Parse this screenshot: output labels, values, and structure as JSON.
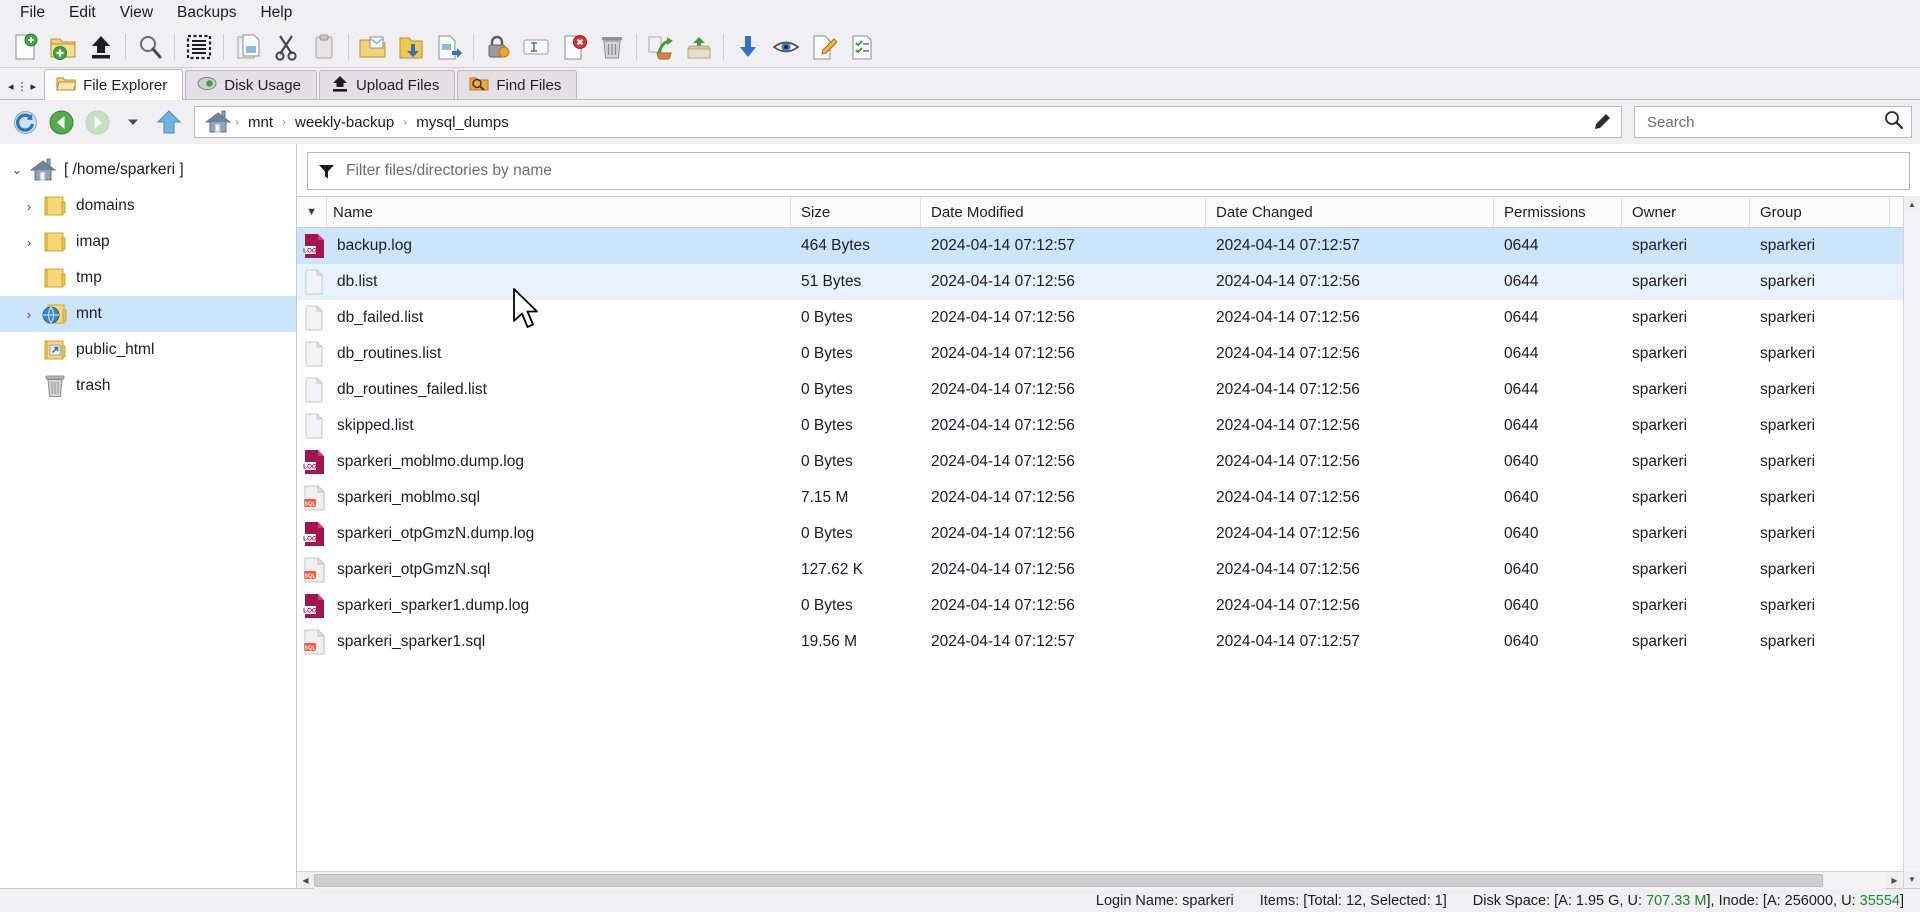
{
  "menubar": {
    "items": [
      {
        "label": "File",
        "name": "menu-file"
      },
      {
        "label": "Edit",
        "name": "menu-edit"
      },
      {
        "label": "View",
        "name": "menu-view"
      },
      {
        "label": "Backups",
        "name": "menu-backups"
      },
      {
        "label": "Help",
        "name": "menu-help"
      }
    ]
  },
  "toolbar": {
    "buttons": [
      {
        "icon": "new-file-icon",
        "group": 0
      },
      {
        "icon": "new-folder-icon",
        "group": 0
      },
      {
        "icon": "upload-icon",
        "group": 0
      },
      {
        "icon": "search-icon",
        "group": 1
      },
      {
        "icon": "select-all-icon",
        "group": 1
      },
      {
        "icon": "copy-icon",
        "group": 2
      },
      {
        "icon": "cut-icon",
        "group": 2
      },
      {
        "icon": "paste-icon",
        "group": 2
      },
      {
        "icon": "move-to-folder-icon",
        "group": 3
      },
      {
        "icon": "download-folder-icon",
        "group": 3
      },
      {
        "icon": "extract-archive-icon",
        "group": 3
      },
      {
        "icon": "permissions-lock-icon",
        "group": 4
      },
      {
        "icon": "rename-icon",
        "group": 4
      },
      {
        "icon": "delete-file-icon",
        "group": 4
      },
      {
        "icon": "trash-icon",
        "group": 4
      },
      {
        "icon": "restore-icon",
        "group": 5
      },
      {
        "icon": "archive-box-icon",
        "group": 5
      },
      {
        "icon": "download-icon",
        "group": 6
      },
      {
        "icon": "preview-eye-icon",
        "group": 6
      },
      {
        "icon": "edit-file-icon",
        "group": 6
      },
      {
        "icon": "checklist-icon",
        "group": 6
      }
    ]
  },
  "tabs": {
    "nav_prev": "◂",
    "nav_more": "⋮",
    "nav_next": "▸",
    "items": [
      {
        "label": "File Explorer",
        "icon": "folder-open-icon",
        "active": true
      },
      {
        "label": "Disk Usage",
        "icon": "disk-usage-icon",
        "active": false
      },
      {
        "label": "Upload Files",
        "icon": "upload-icon",
        "active": false
      },
      {
        "label": "Find Files",
        "icon": "find-files-icon",
        "active": false
      }
    ]
  },
  "addressbar": {
    "refresh_title": "refresh-icon",
    "back_title": "back-icon",
    "forward_title": "forward-icon",
    "history_title": "chevron-down-icon",
    "up_title": "up-icon",
    "home_title": "home-icon",
    "edit_path_title": "edit-path-icon",
    "separator": "›",
    "breadcrumbs": [
      "mnt",
      "weekly-backup",
      "mysql_dumps"
    ]
  },
  "search": {
    "placeholder": "Search",
    "value": "",
    "icon": "search-icon"
  },
  "filter": {
    "placeholder": "Filter files/directories by name",
    "value": "",
    "icon": "filter-funnel-icon"
  },
  "sidebar": {
    "items": [
      {
        "label": "[ /home/sparkeri ]",
        "icon": "home-icon",
        "twisty": "⌄",
        "expanded": true,
        "indent": 0,
        "selected": false,
        "name": "sidebar-item-home"
      },
      {
        "label": "domains",
        "icon": "folder-icon",
        "twisty": "›",
        "expanded": false,
        "indent": 1,
        "selected": false,
        "name": "sidebar-item-domains"
      },
      {
        "label": "imap",
        "icon": "folder-icon",
        "twisty": "›",
        "expanded": false,
        "indent": 1,
        "selected": false,
        "name": "sidebar-item-imap"
      },
      {
        "label": "tmp",
        "icon": "folder-icon",
        "twisty": "",
        "expanded": false,
        "indent": 1,
        "selected": false,
        "name": "sidebar-item-tmp"
      },
      {
        "label": "mnt",
        "icon": "folder-mount-icon",
        "twisty": "›",
        "expanded": false,
        "indent": 1,
        "selected": true,
        "name": "sidebar-item-mnt"
      },
      {
        "label": "public_html",
        "icon": "folder-link-icon",
        "twisty": "",
        "expanded": false,
        "indent": 1,
        "selected": false,
        "name": "sidebar-item-public-html"
      },
      {
        "label": "trash",
        "icon": "trash-icon",
        "twisty": "",
        "expanded": false,
        "indent": 1,
        "selected": false,
        "name": "sidebar-item-trash"
      }
    ]
  },
  "filelist": {
    "sort_indicator": "▼",
    "columns": [
      {
        "label": "Name",
        "key": "name",
        "cls": "c-name"
      },
      {
        "label": "Size",
        "key": "size",
        "cls": "c-size"
      },
      {
        "label": "Date Modified",
        "key": "modified",
        "cls": "c-dmod"
      },
      {
        "label": "Date Changed",
        "key": "changed",
        "cls": "c-dchg"
      },
      {
        "label": "Permissions",
        "key": "permissions",
        "cls": "c-perm"
      },
      {
        "label": "Owner",
        "key": "owner",
        "cls": "c-owner"
      },
      {
        "label": "Group",
        "key": "group",
        "cls": "c-group"
      }
    ],
    "rows": [
      {
        "name": "backup.log",
        "icon": "log-file-icon",
        "size": "464 Bytes",
        "modified": "2024-04-14 07:12:57",
        "changed": "2024-04-14 07:12:57",
        "permissions": "0644",
        "owner": "sparkeri",
        "group": "sparkeri",
        "state": "selected"
      },
      {
        "name": "db.list",
        "icon": "text-file-icon",
        "size": "51 Bytes",
        "modified": "2024-04-14 07:12:56",
        "changed": "2024-04-14 07:12:56",
        "permissions": "0644",
        "owner": "sparkeri",
        "group": "sparkeri",
        "state": "hovered"
      },
      {
        "name": "db_failed.list",
        "icon": "text-file-icon",
        "size": "0 Bytes",
        "modified": "2024-04-14 07:12:56",
        "changed": "2024-04-14 07:12:56",
        "permissions": "0644",
        "owner": "sparkeri",
        "group": "sparkeri",
        "state": ""
      },
      {
        "name": "db_routines.list",
        "icon": "text-file-icon",
        "size": "0 Bytes",
        "modified": "2024-04-14 07:12:56",
        "changed": "2024-04-14 07:12:56",
        "permissions": "0644",
        "owner": "sparkeri",
        "group": "sparkeri",
        "state": ""
      },
      {
        "name": "db_routines_failed.list",
        "icon": "text-file-icon",
        "size": "0 Bytes",
        "modified": "2024-04-14 07:12:56",
        "changed": "2024-04-14 07:12:56",
        "permissions": "0644",
        "owner": "sparkeri",
        "group": "sparkeri",
        "state": ""
      },
      {
        "name": "skipped.list",
        "icon": "text-file-icon",
        "size": "0 Bytes",
        "modified": "2024-04-14 07:12:56",
        "changed": "2024-04-14 07:12:56",
        "permissions": "0644",
        "owner": "sparkeri",
        "group": "sparkeri",
        "state": ""
      },
      {
        "name": "sparkeri_moblmo.dump.log",
        "icon": "log-file-icon",
        "size": "0 Bytes",
        "modified": "2024-04-14 07:12:56",
        "changed": "2024-04-14 07:12:56",
        "permissions": "0640",
        "owner": "sparkeri",
        "group": "sparkeri",
        "state": ""
      },
      {
        "name": "sparkeri_moblmo.sql",
        "icon": "sql-file-icon",
        "size": "7.15 M",
        "modified": "2024-04-14 07:12:56",
        "changed": "2024-04-14 07:12:56",
        "permissions": "0640",
        "owner": "sparkeri",
        "group": "sparkeri",
        "state": ""
      },
      {
        "name": "sparkeri_otpGmzN.dump.log",
        "icon": "log-file-icon",
        "size": "0 Bytes",
        "modified": "2024-04-14 07:12:56",
        "changed": "2024-04-14 07:12:56",
        "permissions": "0640",
        "owner": "sparkeri",
        "group": "sparkeri",
        "state": ""
      },
      {
        "name": "sparkeri_otpGmzN.sql",
        "icon": "sql-file-icon",
        "size": "127.62 K",
        "modified": "2024-04-14 07:12:56",
        "changed": "2024-04-14 07:12:56",
        "permissions": "0640",
        "owner": "sparkeri",
        "group": "sparkeri",
        "state": ""
      },
      {
        "name": "sparkeri_sparker1.dump.log",
        "icon": "log-file-icon",
        "size": "0 Bytes",
        "modified": "2024-04-14 07:12:56",
        "changed": "2024-04-14 07:12:56",
        "permissions": "0640",
        "owner": "sparkeri",
        "group": "sparkeri",
        "state": ""
      },
      {
        "name": "sparkeri_sparker1.sql",
        "icon": "sql-file-icon",
        "size": "19.56 M",
        "modified": "2024-04-14 07:12:57",
        "changed": "2024-04-14 07:12:57",
        "permissions": "0640",
        "owner": "sparkeri",
        "group": "sparkeri",
        "state": ""
      }
    ]
  },
  "statusbar": {
    "login": "Login Name: sparkeri",
    "items": "Items: [Total: 12, Selected: 1]",
    "disk_prefix": "Disk Space: [A: 1.95 G, U: ",
    "disk_used": "707.33 M",
    "disk_suffix": "], Inode: [A: 256000, U: ",
    "inode_used": "35554",
    "inode_suffix": "]"
  },
  "colors": {
    "selection": "#cbe5fa",
    "hover": "#e7f2fc",
    "chrome": "#f0eff1",
    "status_green": "#17892e",
    "log_icon": "#a51450",
    "sql_icon": "#f05a40"
  }
}
